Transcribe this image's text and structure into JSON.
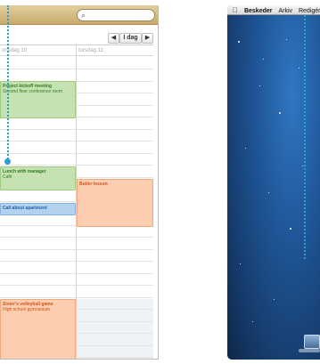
{
  "calendar": {
    "nav": {
      "prev": "◀",
      "today": "I dag",
      "next": "▶"
    },
    "columns": [
      {
        "header": "onsdag 10"
      },
      {
        "header": "torsdag 11"
      }
    ],
    "events": [
      {
        "title": "Project kickoff meeting",
        "subtitle": "Second floor conference room"
      },
      {
        "title": "Lunch with manager",
        "subtitle": "Café"
      },
      {
        "title": "Call about apartment",
        "subtitle": ""
      },
      {
        "title": "Sister's volleyball game",
        "subtitle": "High school gymnasium"
      },
      {
        "title": "Butler lesson",
        "subtitle": ""
      }
    ]
  },
  "desktop": {
    "menubar": {
      "apple": "",
      "app": "Beskeder",
      "item1": "Arkiv",
      "item2": "Redigér"
    }
  },
  "colors": {
    "green": "#c6e2b3",
    "blue": "#b3d2ef",
    "orange": "#fdcdb0",
    "accent": "#2a9fd6"
  }
}
